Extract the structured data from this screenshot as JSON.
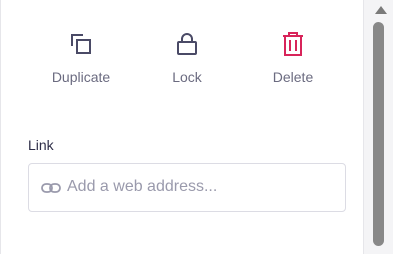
{
  "actions": {
    "duplicate": {
      "label": "Duplicate",
      "icon": "duplicate-icon"
    },
    "lock": {
      "label": "Lock",
      "icon": "lock-icon"
    },
    "delete": {
      "label": "Delete",
      "icon": "trash-icon"
    }
  },
  "link": {
    "heading": "Link",
    "placeholder": "Add a web address...",
    "icon": "link-icon"
  },
  "colors": {
    "icon_default": "#4a4a66",
    "delete_accent": "#d8245a",
    "label_text": "#6b6b80",
    "placeholder_text": "#9a9aac",
    "scrollbar": "#888888"
  }
}
